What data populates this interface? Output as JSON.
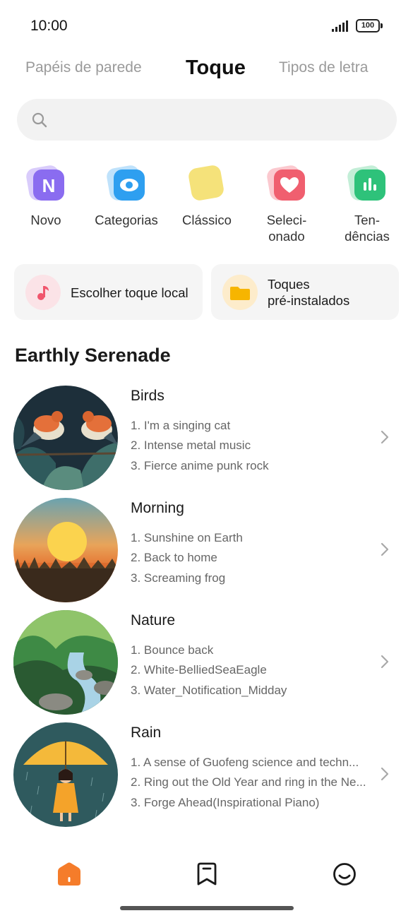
{
  "status": {
    "time": "10:00",
    "battery": "100"
  },
  "tabs": [
    {
      "label": "Papéis de parede",
      "active": false
    },
    {
      "label": "Toque",
      "active": true
    },
    {
      "label": "Tipos de letra",
      "active": false
    }
  ],
  "search": {
    "placeholder": ""
  },
  "categories": [
    {
      "label": "Novo",
      "icon": "new-icon",
      "color": "#8a6cf0"
    },
    {
      "label": "Categorias",
      "icon": "eye-icon",
      "color": "#2e9ff0"
    },
    {
      "label": "Clássico",
      "icon": "classic-icon",
      "color": "#f5e27a"
    },
    {
      "label": "Seleci-\nonado",
      "icon": "heart-icon",
      "color": "#f05f6f"
    },
    {
      "label": "Ten-\ndências",
      "icon": "chart-icon",
      "color": "#2ec27a"
    }
  ],
  "quick_actions": {
    "local": "Escolher toque local",
    "preinstalled": "Toques\npré-instalados"
  },
  "section": {
    "title": "Earthly Serenade"
  },
  "collections": [
    {
      "title": "Birds",
      "image": "birds-image",
      "tracks": [
        "1. I'm a singing cat",
        "2. Intense metal music",
        "3. Fierce anime punk rock"
      ]
    },
    {
      "title": "Morning",
      "image": "sunset-image",
      "tracks": [
        "1. Sunshine on Earth",
        "2. Back to home",
        "3. Screaming frog"
      ]
    },
    {
      "title": "Nature",
      "image": "stream-image",
      "tracks": [
        "1. Bounce back",
        "2. White-BelliedSeaEagle",
        "3. Water_Notification_Midday"
      ]
    },
    {
      "title": "Rain",
      "image": "umbrella-girl-image",
      "tracks": [
        "1. A sense of Guofeng science and techn...",
        "2. Ring out the Old Year and ring in the Ne...",
        "3. Forge Ahead(Inspirational Piano)"
      ]
    }
  ],
  "bottom_nav": [
    {
      "icon": "home-icon",
      "active": true,
      "color": "#f57c2a"
    },
    {
      "icon": "bookmark-icon",
      "active": false
    },
    {
      "icon": "profile-icon",
      "active": false
    }
  ]
}
